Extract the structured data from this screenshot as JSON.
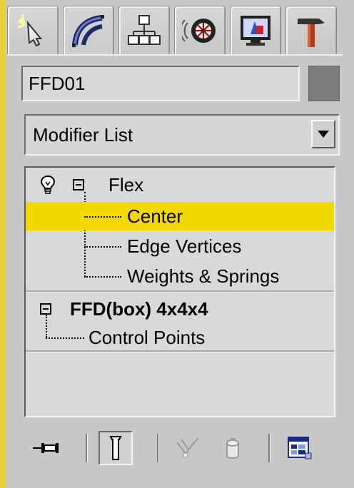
{
  "tabs": [
    {
      "name": "create",
      "icon": "create-cursor-icon"
    },
    {
      "name": "modify",
      "icon": "modify-curve-icon"
    },
    {
      "name": "hierarchy",
      "icon": "hierarchy-icon"
    },
    {
      "name": "motion",
      "icon": "motion-wheel-icon"
    },
    {
      "name": "display",
      "icon": "display-monitor-icon"
    },
    {
      "name": "utilities",
      "icon": "hammer-icon"
    }
  ],
  "active_tab": "modify",
  "object": {
    "name": "FFD01",
    "color": "#7c7c7c"
  },
  "modifier_list": {
    "label": "Modifier List"
  },
  "stack": {
    "flex": {
      "label": "Flex"
    },
    "flex_children": [
      "Center",
      "Edge Vertices",
      "Weights & Springs"
    ],
    "selected": "Center",
    "ffd": {
      "label": "FFD(box) 4x4x4"
    },
    "ffd_children": [
      "Control Points"
    ]
  },
  "toolbar": [
    "pin-stack-icon",
    "show-end-result-icon",
    "make-unique-icon",
    "remove-modifier-icon",
    "configure-modifier-sets-icon"
  ],
  "colors": {
    "selection": "#f3d800",
    "frame_accent": "#e7d23c",
    "panel": "#c8c8c8"
  }
}
